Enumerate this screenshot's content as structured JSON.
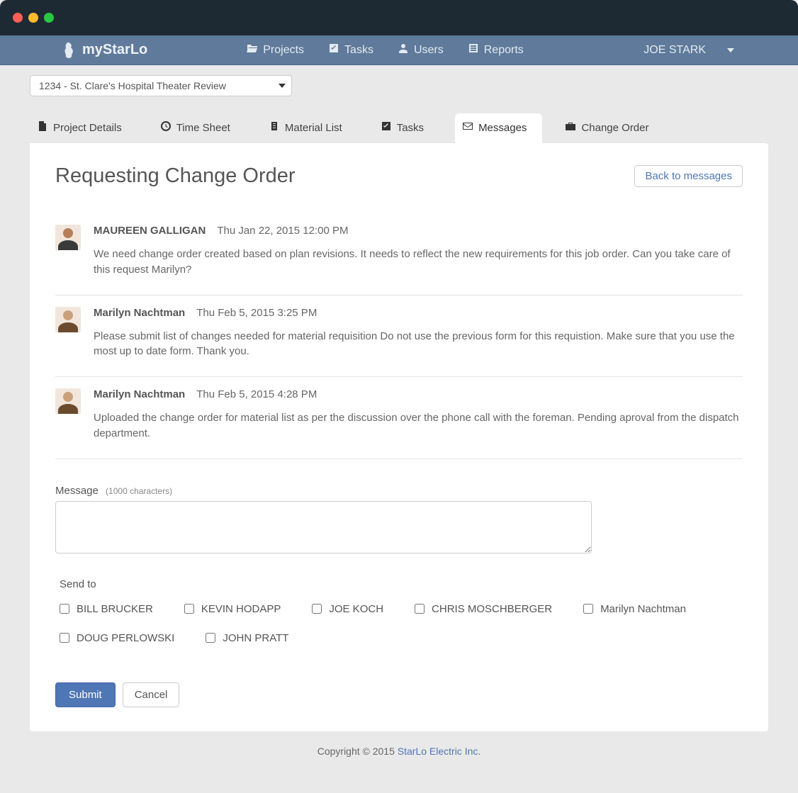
{
  "brand": "myStarLo",
  "nav": {
    "projects": "Projects",
    "tasks": "Tasks",
    "users": "Users",
    "reports": "Reports"
  },
  "current_user": "JOE STARK",
  "project_select": "1234 - St. Clare's Hospital Theater Review",
  "tabs": {
    "project_details": "Project Details",
    "time_sheet": "Time Sheet",
    "material_list": "Material List",
    "tasks": "Tasks",
    "messages": "Messages",
    "change_order": "Change Order"
  },
  "thread": {
    "title": "Requesting Change Order",
    "back_label": "Back to messages",
    "messages": [
      {
        "author": "MAUREEN GALLIGAN",
        "time": "Thu Jan 22, 2015  12:00 PM",
        "text": "We need change order created based on plan revisions.    It needs to reflect the new requirements for this job order.  Can you take care of this request Marilyn?"
      },
      {
        "author": "Marilyn Nachtman",
        "time": "Thu Feb 5, 2015  3:25 PM",
        "text": "Please submit list of changes needed for material requisition    Do not use the previous form for this requistion.  Make sure that you use the most up to date form.  Thank you."
      },
      {
        "author": "Marilyn Nachtman",
        "time": "Thu Feb 5, 2015  4:28 PM",
        "text": "Uploaded the change order for material list as per the discussion over the phone call with the foreman. Pending aproval from the dispatch department."
      }
    ]
  },
  "compose": {
    "label": "Message",
    "hint": "(1000 characters)",
    "sendto_label": "Send to",
    "recipients": [
      "BILL BRUCKER",
      "KEVIN HODAPP",
      "JOE KOCH",
      "CHRIS MOSCHBERGER",
      "Marilyn Nachtman",
      "DOUG PERLOWSKI",
      "JOHN PRATT"
    ],
    "submit_label": "Submit",
    "cancel_label": "Cancel"
  },
  "footer": {
    "prefix": "Copyright © 2015 ",
    "link": "StarLo Electric Inc."
  }
}
